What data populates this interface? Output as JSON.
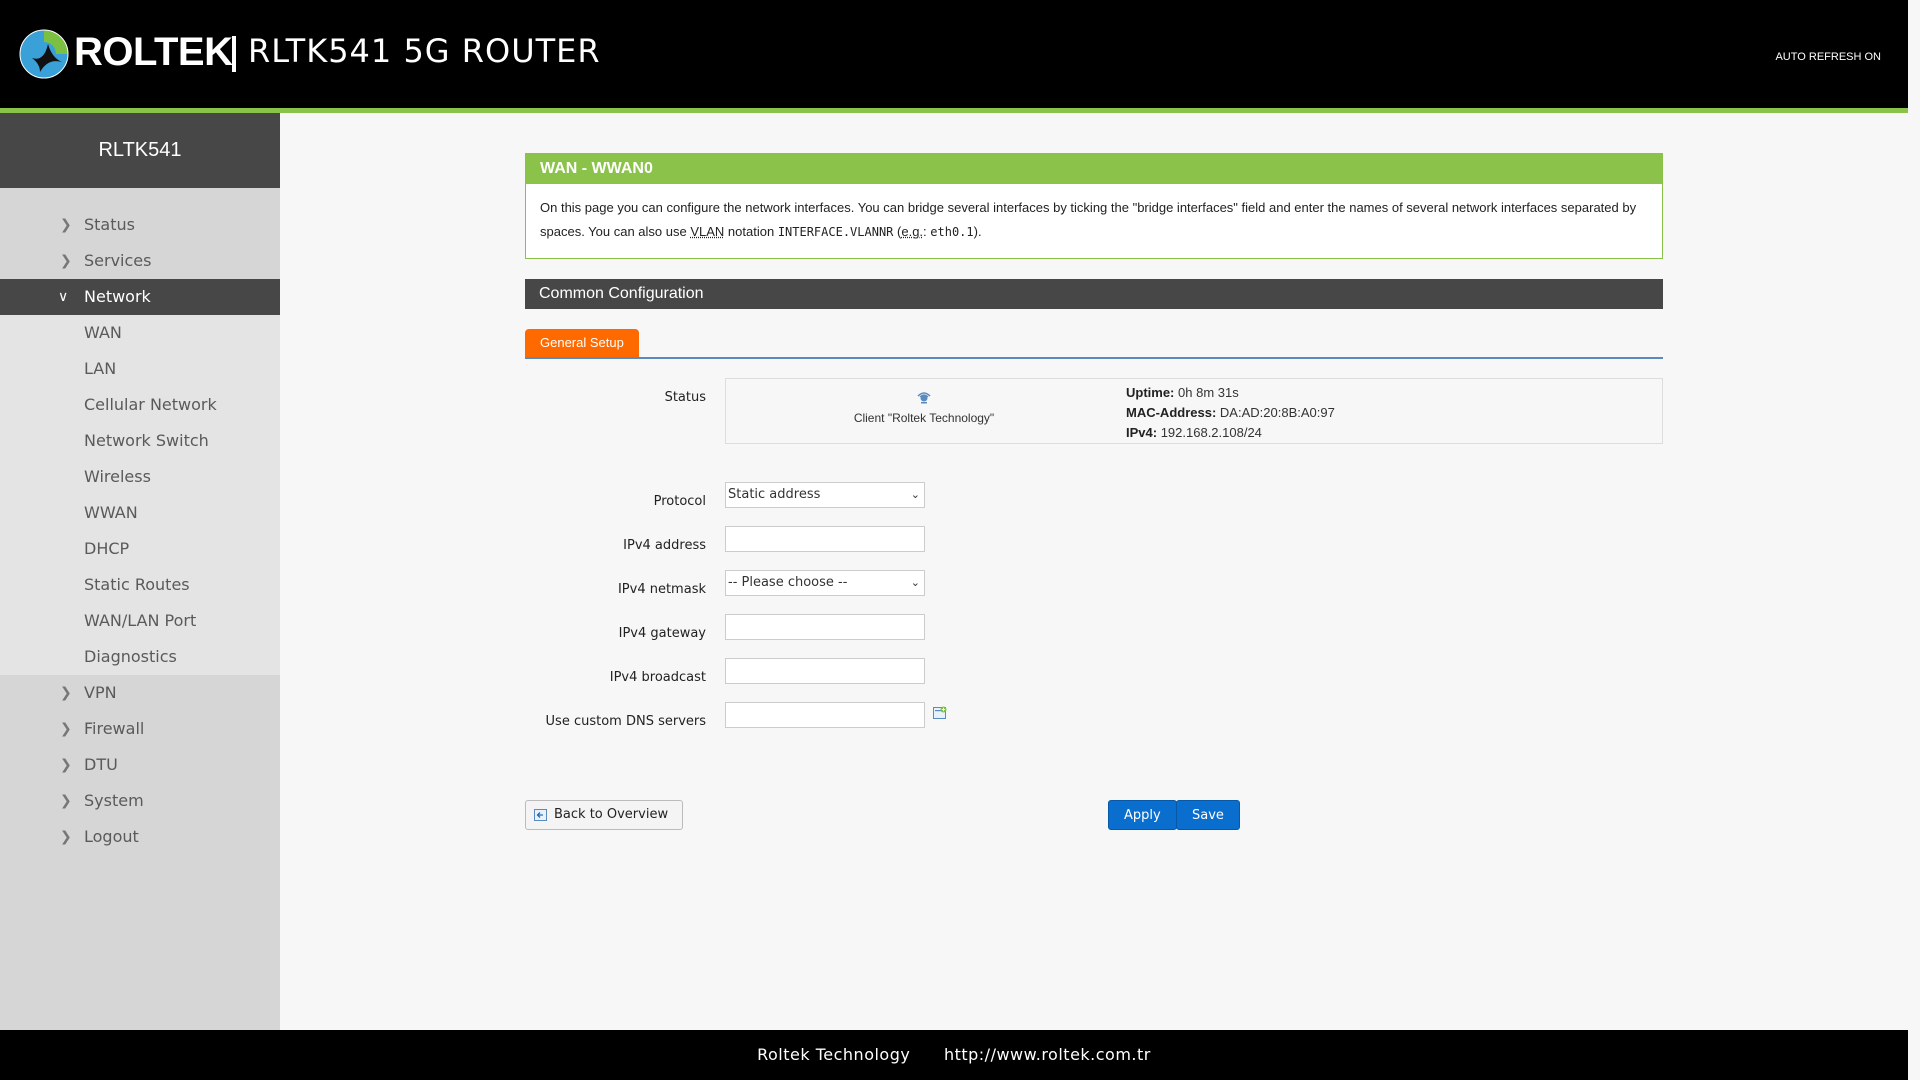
{
  "header": {
    "brand": "ROLTEK",
    "product": "RLTK541 5G ROUTER",
    "auto_refresh": "AUTO REFRESH ON",
    "accent_color": "#8bc34a"
  },
  "sidebar": {
    "hostname": "RLTK541",
    "items": [
      {
        "label": "Status",
        "icon": "chevron-right-icon"
      },
      {
        "label": "Services",
        "icon": "chevron-right-icon"
      },
      {
        "label": "Network",
        "icon": "chevron-down-icon",
        "active": true
      },
      {
        "label": "VPN",
        "icon": "chevron-right-icon"
      },
      {
        "label": "Firewall",
        "icon": "chevron-right-icon"
      },
      {
        "label": "DTU",
        "icon": "chevron-right-icon"
      },
      {
        "label": "System",
        "icon": "chevron-right-icon"
      },
      {
        "label": "Logout",
        "icon": "chevron-right-icon"
      }
    ],
    "network_sub": [
      "WAN",
      "LAN",
      "Cellular Network",
      "Network Switch",
      "Wireless",
      "WWAN",
      "DHCP",
      "Static Routes",
      "WAN/LAN Port",
      "Diagnostics"
    ]
  },
  "wan": {
    "title": "WAN - WWAN0",
    "desc_1": "On this page you can configure the network interfaces. You can bridge several interfaces by ticking the \"bridge interfaces\" field and enter the names of several network interfaces separated by spaces. You can also use ",
    "desc_vlan": "VLAN",
    "desc_2": " notation ",
    "desc_code": "INTERFACE.VLANNR",
    "desc_3": " (",
    "desc_eg": "e.g.",
    "desc_4": ": ",
    "desc_code2": "eth0.1",
    "desc_5": ")."
  },
  "common": {
    "title": "Common Configuration",
    "tab_general": "General Setup"
  },
  "status": {
    "label": "Status",
    "client": "Client \"Roltek Technology\"",
    "uptime_label": "Uptime:",
    "uptime_value": "0h 8m 31s",
    "mac_label": "MAC-Address:",
    "mac_value": "DA:AD:20:8B:A0:97",
    "ipv4_label": "IPv4:",
    "ipv4_value": "192.168.2.108/24"
  },
  "form": {
    "protocol_label": "Protocol",
    "protocol_value": "Static address",
    "ipv4_address_label": "IPv4 address",
    "ipv4_address_value": "",
    "ipv4_netmask_label": "IPv4 netmask",
    "ipv4_netmask_value": "-- Please choose --",
    "ipv4_gateway_label": "IPv4 gateway",
    "ipv4_gateway_value": "",
    "ipv4_broadcast_label": "IPv4 broadcast",
    "ipv4_broadcast_value": "",
    "dns_label": "Use custom DNS servers",
    "dns_value": ""
  },
  "buttons": {
    "back": "Back to Overview",
    "apply": "Apply",
    "save": "Save",
    "primary_color": "#0a6ecf"
  },
  "footer": {
    "company": "Roltek Technology",
    "url": "http://www.roltek.com.tr"
  }
}
